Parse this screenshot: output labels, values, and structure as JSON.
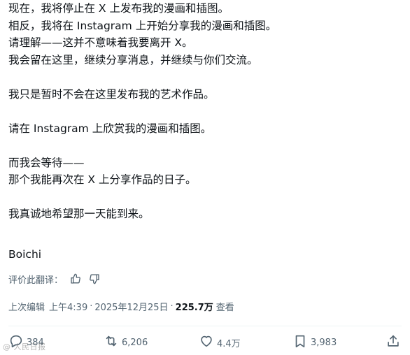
{
  "post": {
    "lines": [
      "现在，我将停止在 X 上发布我的漫画和插图。",
      "相反，我将在 Instagram 上开始分享我的漫画和插图。",
      "请理解——这并不意味着我要离开 X。",
      "我会留在这里，继续分享消息，并继续与你们交流。",
      "",
      "我只是暂时不会在这里发布我的艺术作品。",
      "",
      "请在 Instagram 上欣赏我的漫画和插图。",
      "",
      "而我会等待——",
      "那个我能再次在 X 上分享作品的日子。",
      "",
      "我真诚地希望那一天能到来。"
    ],
    "signature": "Boichi"
  },
  "translation_rating": {
    "label": "评价此翻译：",
    "thumbs_up_icon": "thumbs-up-icon",
    "thumbs_down_icon": "thumbs-down-icon"
  },
  "meta": {
    "edited_label": "上次编辑",
    "time": "上午4:39",
    "separator": "·",
    "date": "2025年12月25日",
    "views_count": "225.7万",
    "views_label": "查看"
  },
  "actions": {
    "reply": {
      "icon": "reply-icon",
      "count": "384"
    },
    "repost": {
      "icon": "repost-icon",
      "count": "6,206"
    },
    "like": {
      "icon": "heart-icon",
      "count": "4.4万"
    },
    "bookmark": {
      "icon": "bookmark-icon",
      "count": "3,983"
    },
    "share": {
      "icon": "share-icon"
    }
  },
  "colors": {
    "text": "#0f1419",
    "secondary": "#536471",
    "divider": "#eff3f4"
  },
  "watermark": "@ 人民日报"
}
